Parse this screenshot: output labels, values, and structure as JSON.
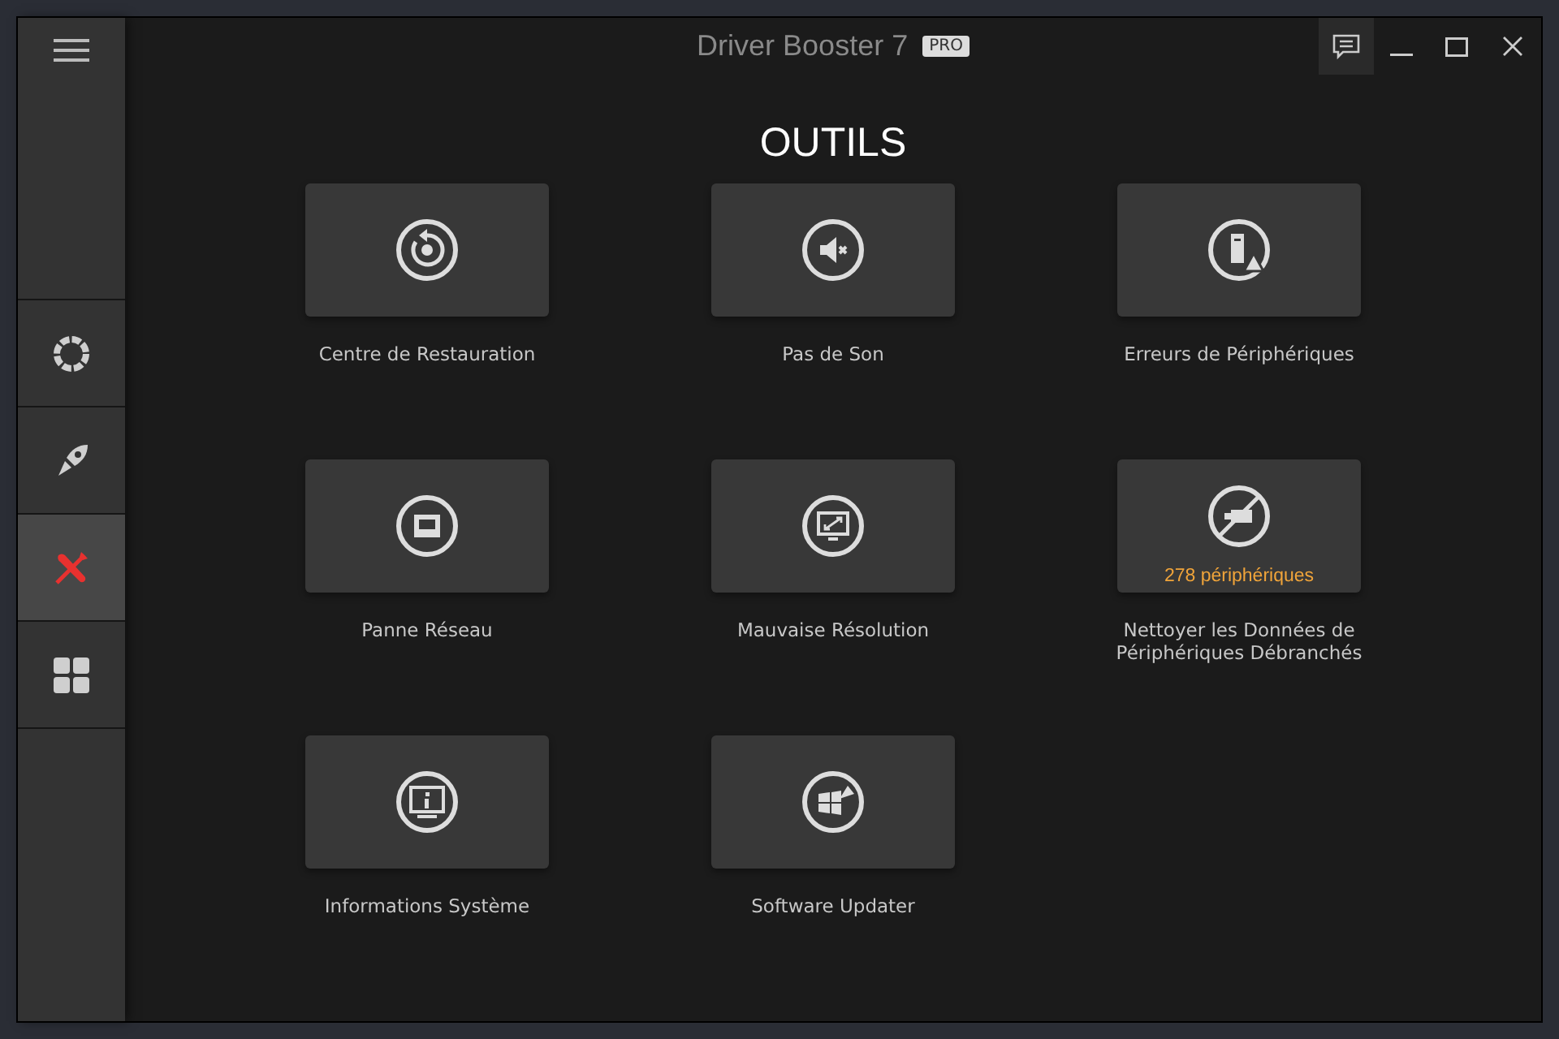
{
  "window": {
    "title": "Driver Booster 7",
    "edition": "PRO"
  },
  "sidebar": {
    "items": [
      {
        "selected": false
      },
      {
        "selected": false
      },
      {
        "selected": true
      },
      {
        "selected": false
      }
    ]
  },
  "page": {
    "heading": "OUTILS"
  },
  "tools": [
    {
      "label": "Centre de Restauration"
    },
    {
      "label": "Pas de Son"
    },
    {
      "label": "Erreurs de Périphériques"
    },
    {
      "label": "Panne Réseau"
    },
    {
      "label": "Mauvaise Résolution"
    },
    {
      "label": "Nettoyer les Données de Périphériques Débranchés",
      "badge": "278 périphériques"
    },
    {
      "label": "Informations Système"
    },
    {
      "label": "Software Updater"
    }
  ]
}
